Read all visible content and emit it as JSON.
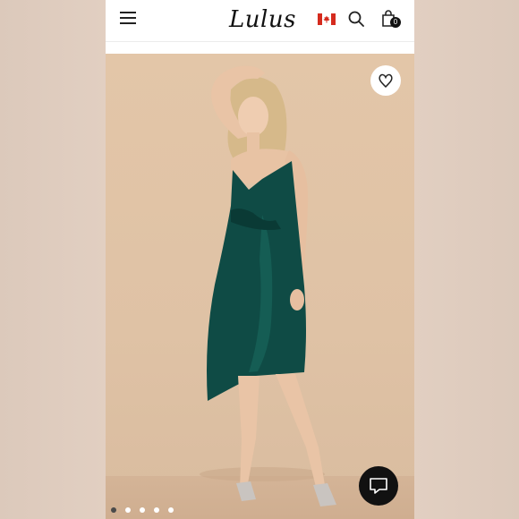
{
  "header": {
    "logo_text": "Lulus",
    "cart_count": "0",
    "icons": [
      "hamburger-menu-icon",
      "canada-flag-icon",
      "search-icon",
      "shopping-bag-icon"
    ]
  },
  "product": {
    "image": "model-in-green-satin-wrap-midi-dress",
    "dress_color": "#0f4b45",
    "wishlist_icon": "heart-icon"
  },
  "carousel": {
    "total": 5,
    "active": 1
  },
  "chat": {
    "icon": "chat-bubble-icon"
  },
  "colors": {
    "header_bg": "#ffffff",
    "backdrop": "#e3c6a8",
    "accent": "#111111"
  }
}
